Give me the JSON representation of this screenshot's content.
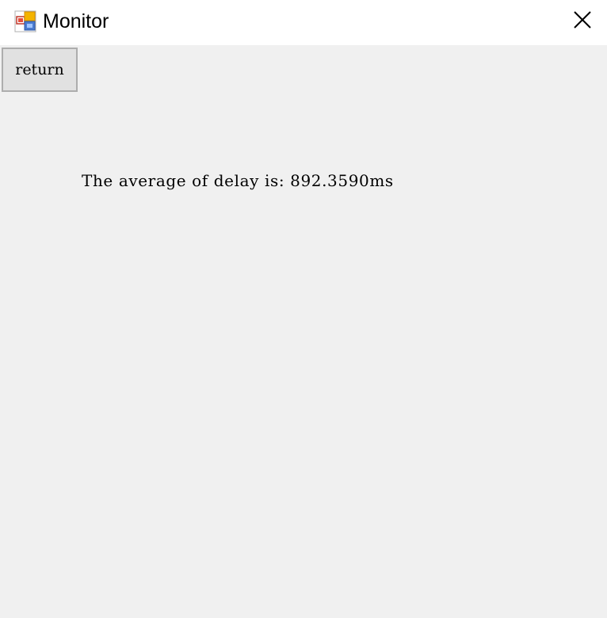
{
  "window": {
    "title": "Monitor",
    "app_icon": "windows-forms-app-icon",
    "close_icon": "close-x-icon"
  },
  "main": {
    "return_button_label": "return",
    "delay_message": "The average of delay is: 892.3590ms"
  },
  "colors": {
    "titlebar_bg": "#ffffff",
    "client_bg": "#f0f0f0",
    "button_bg": "#e1e1e1",
    "button_border": "#adadad",
    "text": "#000000"
  }
}
